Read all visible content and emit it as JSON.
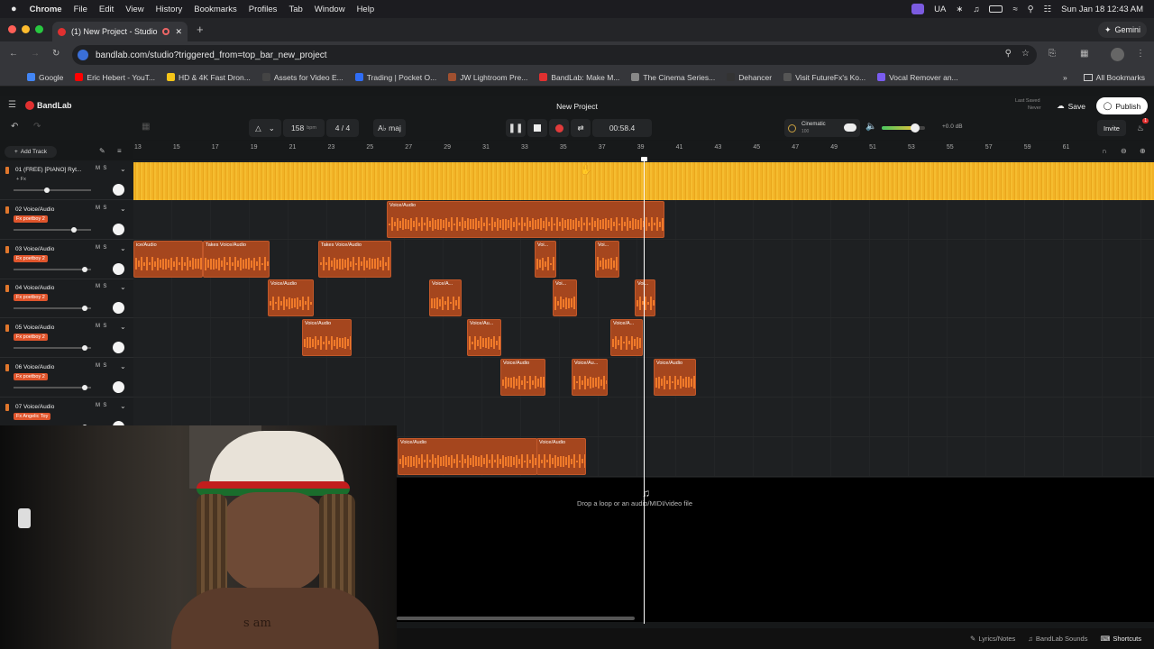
{
  "menubar": {
    "app": "Chrome",
    "items": [
      "File",
      "Edit",
      "View",
      "History",
      "Bookmarks",
      "Profiles",
      "Tab",
      "Window",
      "Help"
    ],
    "country": "UA",
    "datetime": "Sun Jan 18  12:43 AM"
  },
  "tabs": [
    {
      "label": "(1) New Project - Studio"
    }
  ],
  "gemini_label": "Gemini",
  "address": {
    "url": "bandlab.com/studio?triggered_from=top_bar_new_project"
  },
  "bookmarks": [
    {
      "label": "Google",
      "color": "#4285f4"
    },
    {
      "label": "Eric Hebert - YouT...",
      "color": "#ff0000"
    },
    {
      "label": "HD & 4K Fast Dron...",
      "color": "#f5c518"
    },
    {
      "label": "Assets for Video E...",
      "color": "#444444"
    },
    {
      "label": "Trading | Pocket O...",
      "color": "#2f6df6"
    },
    {
      "label": "JW Lightroom Pre...",
      "color": "#a05030"
    },
    {
      "label": "BandLab: Make M...",
      "color": "#e03030"
    },
    {
      "label": "The Cinema Series...",
      "color": "#888888"
    },
    {
      "label": "Dehancer",
      "color": "#333333"
    },
    {
      "label": "Visit FutureFx's Ko...",
      "color": "#555555"
    },
    {
      "label": "Vocal Remover an...",
      "color": "#7a5cf0"
    }
  ],
  "all_bookmarks": "All Bookmarks",
  "bandlab": {
    "logo": "BandLab",
    "project_title": "New Project",
    "last_saved_label": "Last Saved",
    "last_saved_value": "Never",
    "save": "Save",
    "publish": "Publish",
    "invite": "Invite",
    "notification_count": "1"
  },
  "transport": {
    "bpm": "158",
    "bpm_unit": "bpm",
    "time_sig": "4 / 4",
    "key": "A♭ maj",
    "time": "00:58.4",
    "preset_name": "Cinematic",
    "preset_value": "100",
    "volume": "+0.0 dB",
    "volume_level": 0.78
  },
  "add_track": "Add Track",
  "ruler": [
    "13",
    "15",
    "17",
    "19",
    "21",
    "23",
    "25",
    "27",
    "29",
    "31",
    "33",
    "35",
    "37",
    "39",
    "41",
    "43",
    "45",
    "47",
    "49",
    "51",
    "53",
    "55",
    "57",
    "59",
    "61"
  ],
  "tracks": [
    {
      "name": "01  (FREE) [PIANO] Ryt...",
      "fx": "+ Fx",
      "fader": 0.43
    },
    {
      "name": "02  Voice/Audio",
      "fx": "Fx  poetboy 2",
      "fader": 0.8
    },
    {
      "name": "03  Voice/Audio",
      "fx": "Fx  poetboy 2",
      "fader": 0.95
    },
    {
      "name": "04  Voice/Audio",
      "fx": "Fx  poetboy 2",
      "fader": 0.95
    },
    {
      "name": "05  Voice/Audio",
      "fx": "Fx  poetboy 2",
      "fader": 0.95
    },
    {
      "name": "06  Voice/Audio",
      "fx": "Fx  poetboy 2",
      "fader": 0.95
    },
    {
      "name": "07  Voice/Audio",
      "fx": "Fx  Angelic Toy",
      "fader": 0.95
    }
  ],
  "track_controls": {
    "mute": "M",
    "solo": "S"
  },
  "clips": [
    {
      "lane": 1,
      "label": "Voice/Audio"
    },
    {
      "lane": 2,
      "label": "ice/Audio"
    },
    {
      "lane": 2,
      "label": "Takes  Voice/Audio"
    },
    {
      "lane": 2,
      "label": "Takes  Voice/Audio"
    },
    {
      "lane": 2,
      "label": "Voi..."
    },
    {
      "lane": 2,
      "label": "Voi..."
    },
    {
      "lane": 3,
      "label": "Voice/Audio"
    },
    {
      "lane": 3,
      "label": "Voice/A..."
    },
    {
      "lane": 3,
      "label": "Voi..."
    },
    {
      "lane": 3,
      "label": "Voi..."
    },
    {
      "lane": 4,
      "label": "Voice/Audio"
    },
    {
      "lane": 4,
      "label": "Voice/Au..."
    },
    {
      "lane": 4,
      "label": "Voice/A..."
    },
    {
      "lane": 5,
      "label": "Voice/Audio"
    },
    {
      "lane": 5,
      "label": "Voice/Au..."
    },
    {
      "lane": 5,
      "label": "Voice/Audio"
    },
    {
      "lane": 7,
      "label": "Voice/Audio"
    },
    {
      "lane": 7,
      "label": "Voice/Audio"
    }
  ],
  "drop_text": "Drop a loop or an audio/MIDI/video file",
  "bottom": {
    "lyrics": "Lyrics/Notes",
    "sounds": "BandLab Sounds",
    "shortcuts": "Shortcuts"
  },
  "webcam_text": "s am"
}
